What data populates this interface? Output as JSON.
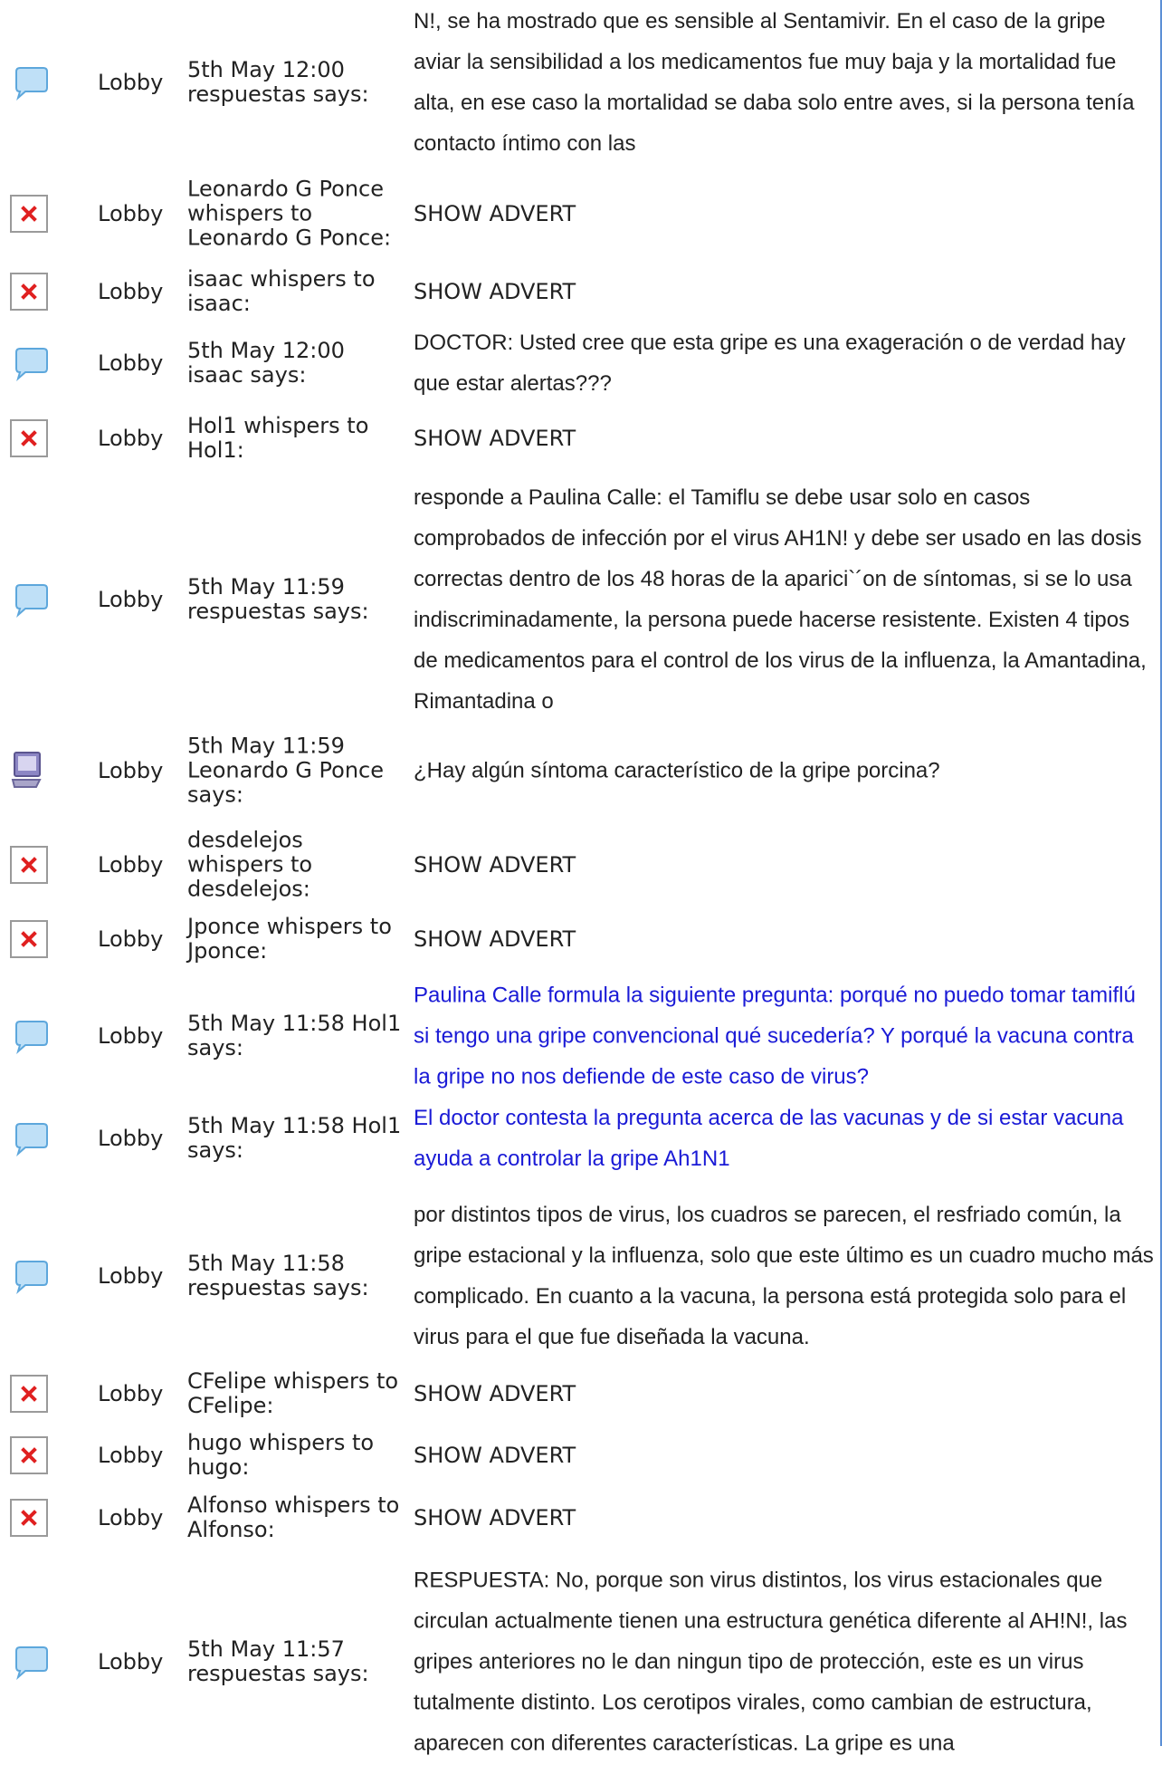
{
  "colors": {
    "accent_blue": "#1a1ad6",
    "border_blue": "#5b8fd6"
  },
  "rows": [
    {
      "icon": "chat-bubble-icon",
      "room": "Lobby",
      "sender": "5th May 12:00 respuestas says:",
      "message": "N!, se ha mostrado que es sensible al Sentamivir. En el caso de la gripe aviar la sensibilidad a los medicamentos fue muy baja y la mortalidad fue alta, en ese caso la mortalidad se daba solo entre aves, si la persona tenía contacto íntimo con las",
      "style": "normal"
    },
    {
      "icon": "broken-image-icon",
      "room": "Lobby",
      "sender": "Leonardo G Ponce whispers to Leonardo G Ponce:",
      "message": "SHOW ADVERT",
      "style": "ad"
    },
    {
      "icon": "broken-image-icon",
      "room": "Lobby",
      "sender": "isaac whispers to isaac:",
      "message": "SHOW ADVERT",
      "style": "ad"
    },
    {
      "icon": "chat-bubble-icon",
      "room": "Lobby",
      "sender": "5th May 12:00 isaac says:",
      "message": "DOCTOR: Usted cree que esta gripe es una exageración o de verdad hay que estar alertas???",
      "style": "normal"
    },
    {
      "icon": "broken-image-icon",
      "room": "Lobby",
      "sender": "Hol1 whispers to Hol1:",
      "message": "SHOW ADVERT",
      "style": "ad"
    },
    {
      "icon": "chat-bubble-icon",
      "room": "Lobby",
      "sender": "5th May 11:59 respuestas says:",
      "message": "responde a Paulina Calle: el Tamiflu se debe usar solo en casos comprobados de infección por el virus AH1N! y debe ser usado en las dosis correctas dentro de los 48 horas de la aparici`´on de síntomas, si se lo usa indiscriminadamente, la persona puede hacerse resistente. Existen 4 tipos de medicamentos para el control de los virus de la influenza, la Amantadina, Rimantadina o",
      "style": "normal"
    },
    {
      "icon": "computer-monitor-icon",
      "room": "Lobby",
      "sender": "5th May 11:59 Leonardo G Ponce says:",
      "message": "¿Hay algún síntoma característico de la gripe porcina?",
      "style": "normal"
    },
    {
      "icon": "broken-image-icon",
      "room": "Lobby",
      "sender": "desdelejos whispers to desdelejos:",
      "message": "SHOW ADVERT",
      "style": "ad"
    },
    {
      "icon": "broken-image-icon",
      "room": "Lobby",
      "sender": "Jponce whispers to Jponce:",
      "message": "SHOW ADVERT",
      "style": "ad"
    },
    {
      "icon": "chat-bubble-icon",
      "room": "Lobby",
      "sender": "5th May 11:58 Hol1 says:",
      "message": "Paulina Calle formula la siguiente pregunta: porqué no puedo tomar tamiflú si tengo una gripe convencional qué sucedería? Y porqué la vacuna contra la gripe no nos defiende de este caso de virus?",
      "style": "blue"
    },
    {
      "icon": "chat-bubble-icon",
      "room": "Lobby",
      "sender": "5th May 11:58 Hol1 says:",
      "message": "El doctor contesta la pregunta acerca de las vacunas y de si estar vacuna ayuda a controlar la gripe Ah1N1",
      "style": "blue"
    },
    {
      "icon": "chat-bubble-icon",
      "room": "Lobby",
      "sender": "5th May 11:58 respuestas says:",
      "message": "por distintos tipos de virus, los cuadros se parecen, el resfriado común, la gripe estacional y la influenza, solo que este último es un cuadro mucho más complicado. En cuanto a la vacuna, la persona está protegida solo para el virus para el que fue diseñada la vacuna.",
      "style": "normal"
    },
    {
      "icon": "broken-image-icon",
      "room": "Lobby",
      "sender": "CFelipe whispers to CFelipe:",
      "message": "SHOW ADVERT",
      "style": "ad"
    },
    {
      "icon": "broken-image-icon",
      "room": "Lobby",
      "sender": "hugo whispers to hugo:",
      "message": "SHOW ADVERT",
      "style": "ad"
    },
    {
      "icon": "broken-image-icon",
      "room": "Lobby",
      "sender": "Alfonso whispers to Alfonso:",
      "message": "SHOW ADVERT",
      "style": "ad"
    },
    {
      "icon": "chat-bubble-icon",
      "room": "Lobby",
      "sender": "5th May 11:57 respuestas says:",
      "message": "RESPUESTA: No, porque son virus distintos, los virus estacionales que circulan actualmente tienen una estructura genética diferente al AH!N!, las gripes anteriores no le dan ningun tipo de protección, este es un virus tutalmente distinto. Los cerotipos virales, como cambian de estructura, aparecen con diferentes características. La gripe es una",
      "style": "normal"
    }
  ]
}
